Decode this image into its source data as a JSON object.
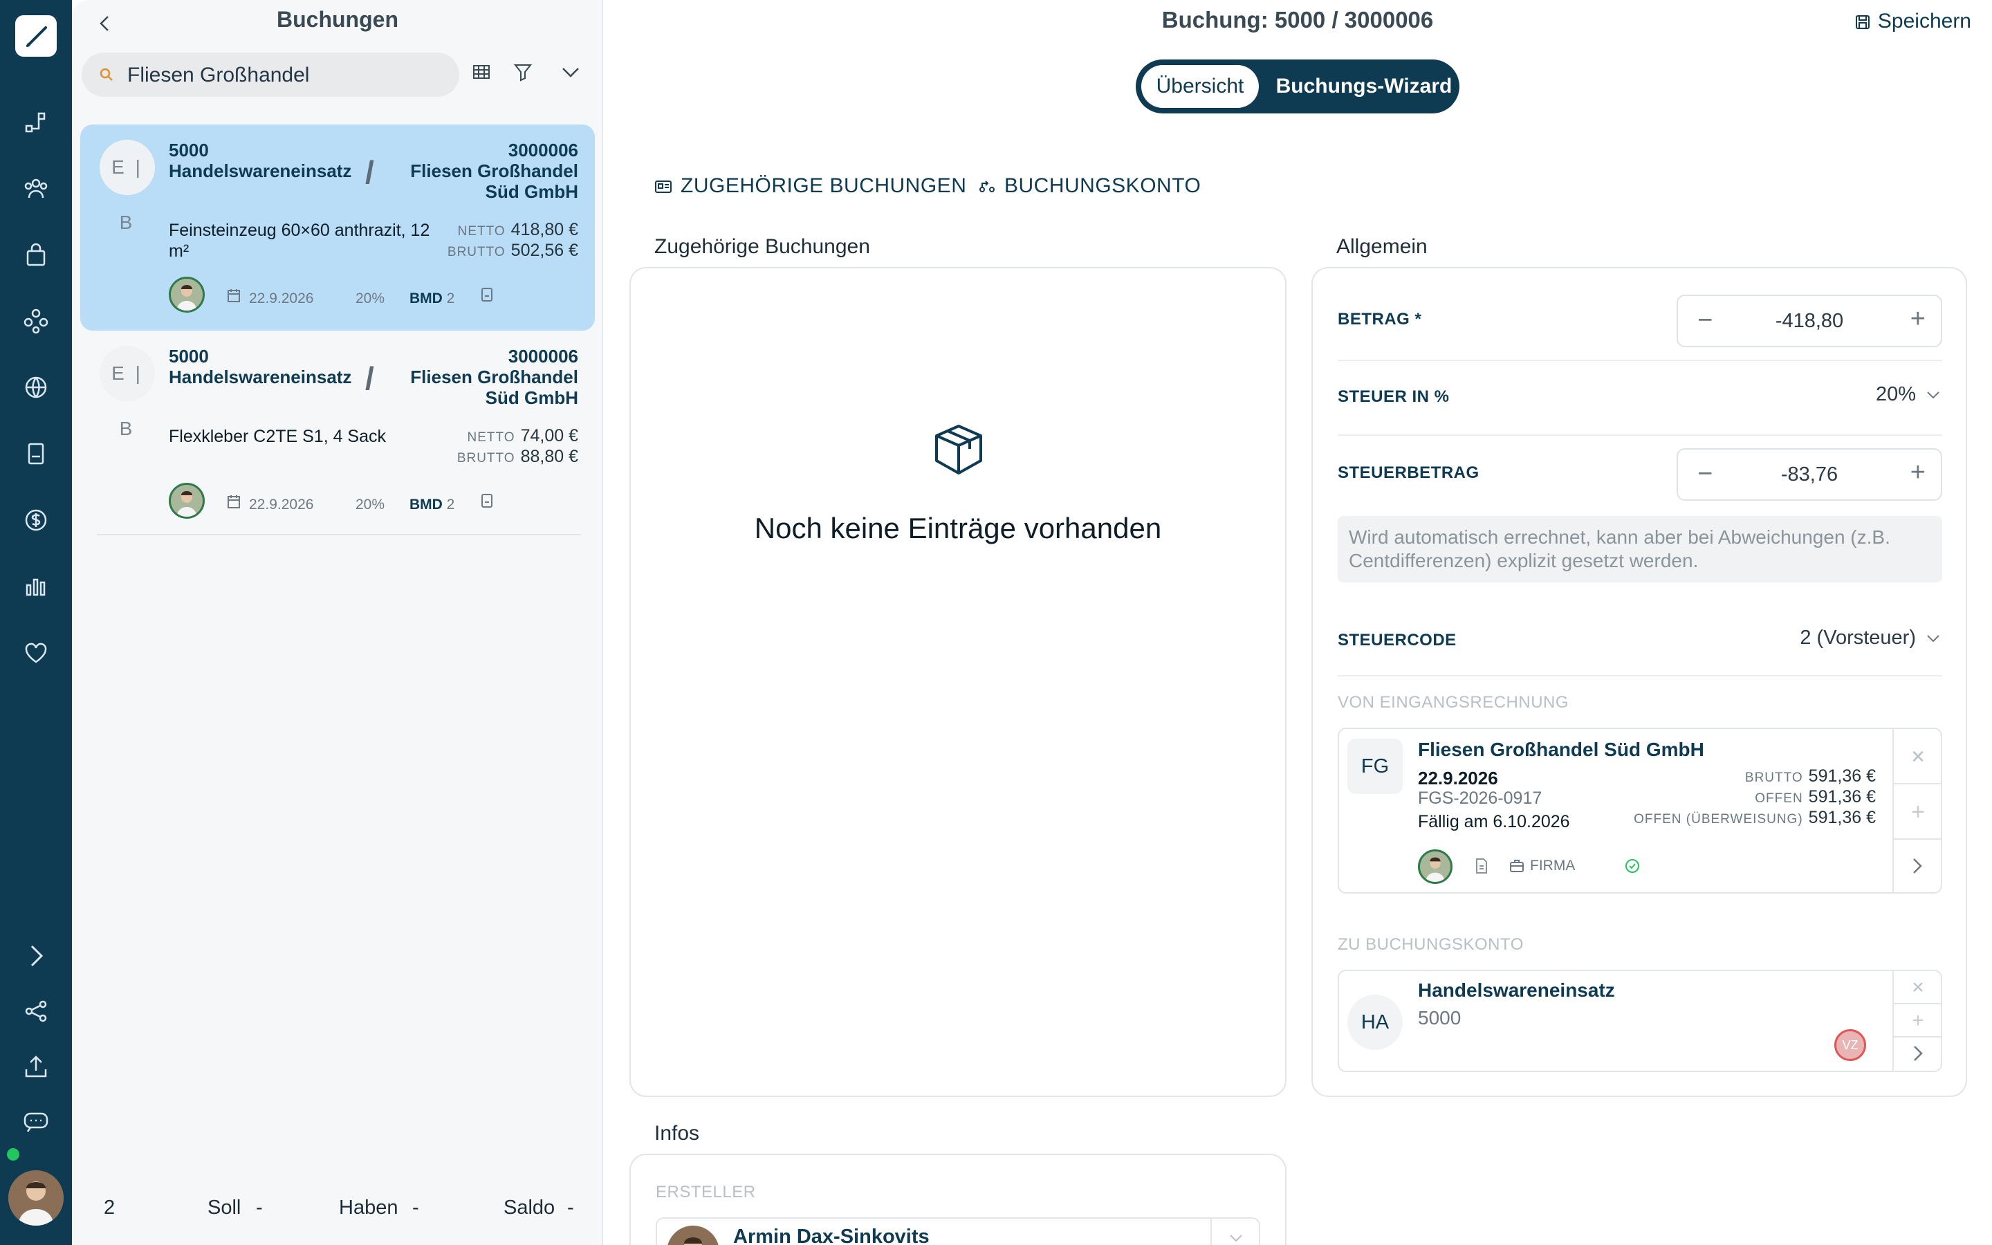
{
  "left_panel": {
    "title": "Buchungen",
    "search_value": "Fliesen Großhandel",
    "cards": [
      {
        "initials": "E | B",
        "account_no": "5000",
        "account_name": "Handelswareneinsatz",
        "doc_no": "3000006",
        "partner_line1": "Fliesen Großhandel",
        "partner_line2": "Süd GmbH",
        "description": "Feinsteinzeug 60×60 anthrazit, 12 m²",
        "netto_label": "NETTO",
        "netto": "418,80 €",
        "brutto_label": "BRUTTO",
        "brutto": "502,56 €",
        "date": "22.9.2026",
        "tax": "20%",
        "bmd_label": "BMD",
        "bmd": "2"
      },
      {
        "initials": "E | B",
        "account_no": "5000",
        "account_name": "Handelswareneinsatz",
        "doc_no": "3000006",
        "partner_line1": "Fliesen Großhandel",
        "partner_line2": "Süd GmbH",
        "description": "Flexkleber C2TE S1, 4 Sack",
        "netto_label": "NETTO",
        "netto": "74,00 €",
        "brutto_label": "BRUTTO",
        "brutto": "88,80 €",
        "date": "22.9.2026",
        "tax": "20%",
        "bmd_label": "BMD",
        "bmd": "2"
      }
    ],
    "footer": {
      "count": "2",
      "soll_label": "Soll",
      "soll": "-",
      "haben_label": "Haben",
      "haben": "-",
      "saldo_label": "Saldo",
      "saldo": "-"
    }
  },
  "header": {
    "title": "Buchung: 5000 / 3000006",
    "save_label": "Speichern",
    "segment": [
      "Übersicht",
      "Buchungs-Wizard"
    ]
  },
  "tabs": [
    "ZUGEHÖRIGE BUCHUNGEN",
    "BUCHUNGSKONTO"
  ],
  "related": {
    "title": "Zugehörige Buchungen",
    "empty_text": "Noch keine Einträge vorhanden"
  },
  "general": {
    "title": "Allgemein",
    "betrag_label": "BETRAG *",
    "betrag": "-418,80",
    "steuer_label": "STEUER IN %",
    "steuer": "20%",
    "steuerbetrag_label": "STEUERBETRAG",
    "steuerbetrag": "-83,76",
    "hint": "Wird automatisch errechnet, kann aber bei Abweichungen (z.B. Centdifferenzen) explizit gesetzt werden.",
    "steuercode_label": "STEUERCODE",
    "steuercode": "2 (Vorsteuer)",
    "invoice_caption": "VON EINGANGSRECHNUNG",
    "invoice": {
      "initials": "FG",
      "name": "Fliesen Großhandel Süd GmbH",
      "date": "22.9.2026",
      "number": "FGS-2026-0917",
      "due": "Fällig am 6.10.2026",
      "brutto_label": "BRUTTO",
      "brutto": "591,36 €",
      "offen_label": "OFFEN",
      "offen": "591,36 €",
      "offen_transfer_label": "OFFEN (ÜBERWEISUNG)",
      "offen_transfer": "591,36 €",
      "firma_label": "FIRMA"
    },
    "account_caption": "ZU BUCHUNGSKONTO",
    "account": {
      "initials": "HA",
      "name": "Handelswareneinsatz",
      "number": "5000",
      "badge": "VZ"
    }
  },
  "infos": {
    "title": "Infos",
    "creator_caption": "ERSTELLER",
    "creator_name": "Armin Dax-Sinkovits"
  },
  "colors": {
    "rail": "#0e3a52",
    "selected_card": "#b9dcf7",
    "accent": "#0e3a52",
    "success": "#22c55e"
  }
}
